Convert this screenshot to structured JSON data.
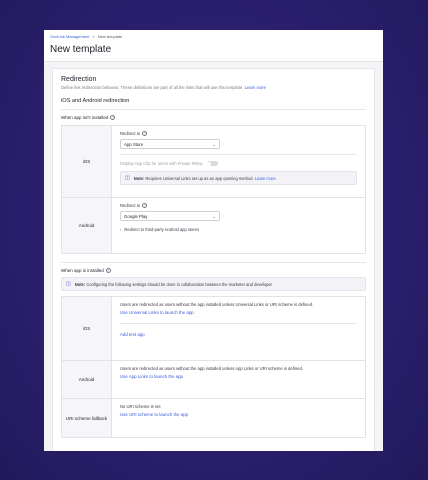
{
  "breadcrumb": {
    "parent": "OneLink Management",
    "separator": ">",
    "current": "New template"
  },
  "page": {
    "title": "New template"
  },
  "redirection": {
    "title": "Redirection",
    "description": "Define link redirection behavior. These definitions are part of all the links that will use this template.",
    "learn_more": "Learn more",
    "subtitle": "iOS and Android redirection"
  },
  "not_installed": {
    "label": "When app isn't installed",
    "ios": {
      "label": "iOS",
      "redirect_label": "Redirect to",
      "select_value": "App Store",
      "toggle_label": "Display App Clip for users with Private Relay",
      "note_bold": "Note:",
      "note_text": "Requires Universal Links set up as an app opening method.",
      "note_link": "Learn more"
    },
    "android": {
      "label": "Android",
      "redirect_label": "Redirect to",
      "select_value": "Google Play",
      "expander": "Redirect to third-party Android app stores"
    }
  },
  "installed": {
    "label": "When app is installed",
    "note_bold": "Note:",
    "note_text": "Configuring the following settings should be done in collaboration between the marketer and developer",
    "ios": {
      "label": "iOS",
      "text": "Users are redirected as users without the app installed unless Universal Links or URI scheme is defined.",
      "link": "Use Universal Links to launch the app",
      "add_test": "Add test app"
    },
    "android": {
      "label": "Android",
      "text": "Users are redirected as users without the app installed unless App Links or URI scheme is defined.",
      "link": "Use App Links to launch the app"
    },
    "uri": {
      "label": "URI scheme fallback",
      "text": "No URI scheme is set",
      "link": "Use URI scheme to launch the app"
    }
  },
  "icons": {
    "help": "question-circle-icon",
    "note": "chat-note-icon",
    "chevron": "chevron-down-icon",
    "expand": "chevron-right-icon"
  },
  "colors": {
    "background": "#2a1f6e",
    "accent": "#3b5bdb",
    "note_icon": "#6b4fd8"
  }
}
